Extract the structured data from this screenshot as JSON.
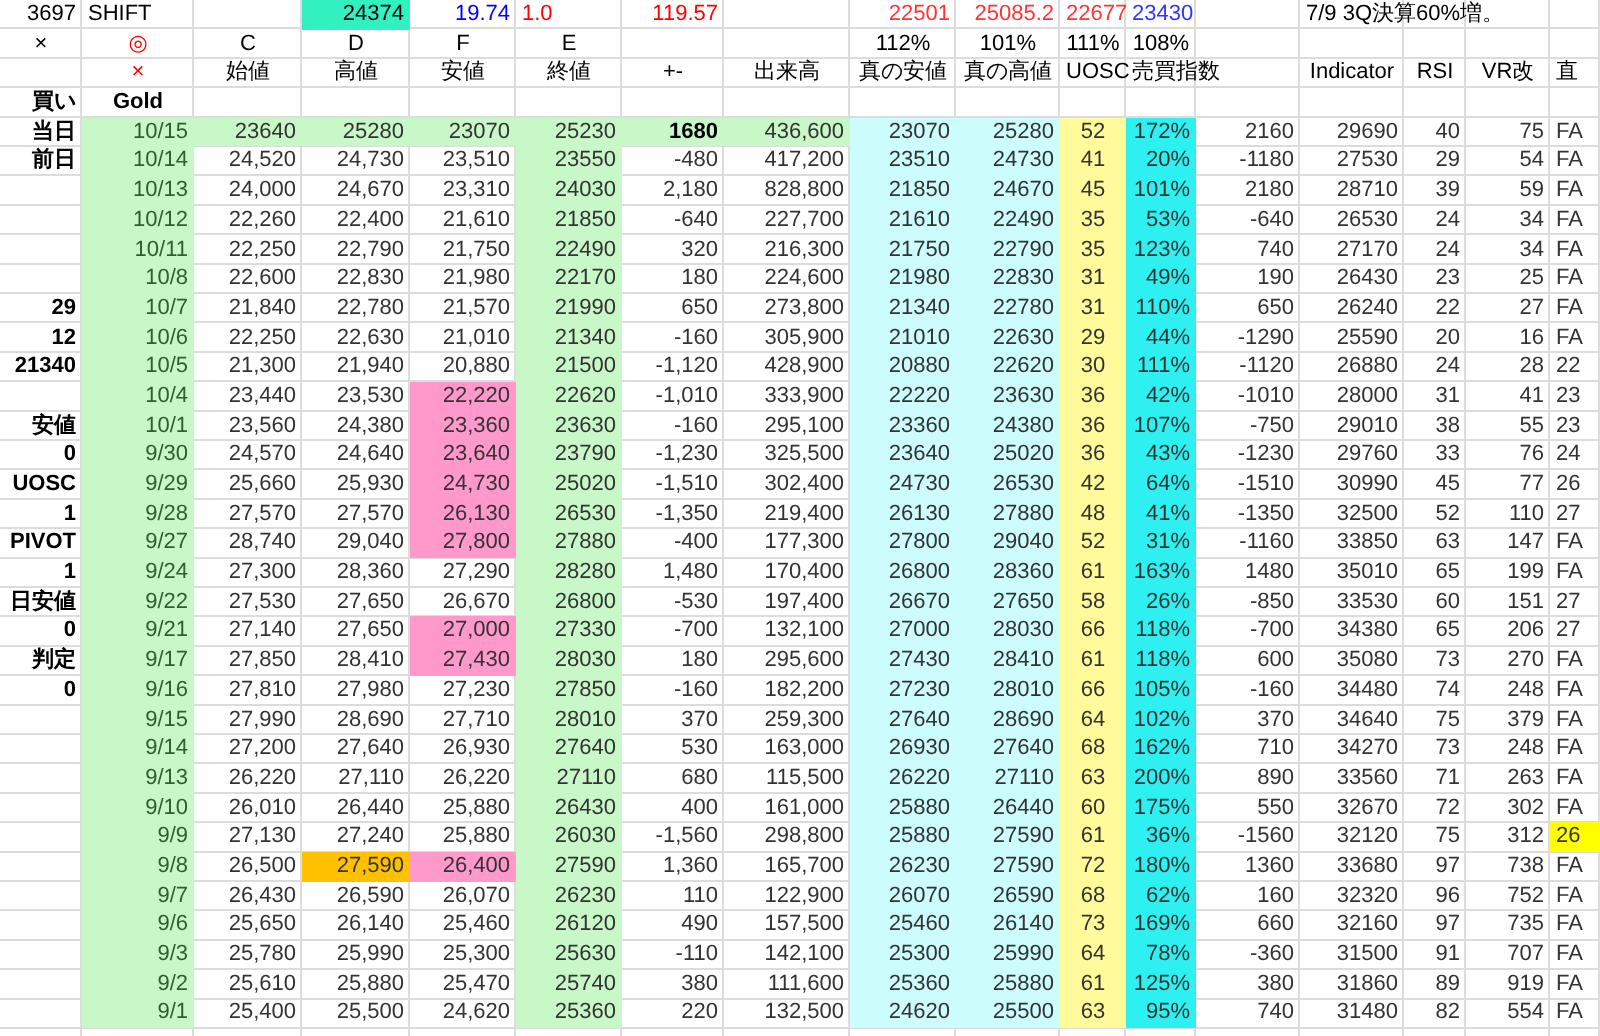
{
  "header_rows": [
    [
      {
        "text": "3697",
        "color": "#000000",
        "highlighted": false
      },
      {
        "text": "SHIFT",
        "color": "#000000",
        "highlighted": false
      },
      null,
      {
        "text": "24374",
        "highlighted": true
      },
      {
        "text": "19.74",
        "color": "#0000ff",
        "highlighted": false
      },
      {
        "text": "1.0",
        "color": "#ff0000",
        "highlighted": false
      },
      {
        "text": "119.57",
        "color": "#ff0000",
        "highlighted": false
      },
      null,
      {
        "text": "22501",
        "color": "#ff3333",
        "highlighted": false
      },
      {
        "text": "25085.2",
        "color": "#ff3333",
        "highlighted": false
      },
      {
        "text": "22677",
        "color": "#ff3333",
        "highlighted": false
      },
      {
        "text": "23430",
        "color": "#3333ff",
        "highlighted": false
      },
      null,
      {
        "text": "7/9 3Q決算60%増。",
        "color": "#000000",
        "highlighted": false
      },
      null,
      null,
      null
    ],
    [
      {
        "text": "×",
        "color": "#000000"
      },
      {
        "text": "◎",
        "color": "#ff0000"
      },
      {
        "text": "C",
        "color": "#000000"
      },
      {
        "text": "D",
        "color": "#000000"
      },
      {
        "text": "F",
        "color": "#000000"
      },
      {
        "text": "E",
        "color": "#000000"
      },
      null,
      null,
      {
        "text": "112%",
        "color": "#000000"
      },
      {
        "text": "101%",
        "color": "#000000"
      },
      {
        "text": "111%",
        "color": "#000000"
      },
      {
        "text": "108%",
        "color": "#000000"
      },
      null,
      null,
      null,
      null,
      null
    ],
    [
      null,
      {
        "text": "×",
        "color": "#ff0000"
      },
      {
        "text": "始値",
        "color": "#000000"
      },
      {
        "text": "高値",
        "color": "#000000"
      },
      {
        "text": "安値",
        "color": "#000000"
      },
      {
        "text": "終値",
        "color": "#000000"
      },
      {
        "text": "+-",
        "color": "#000000"
      },
      {
        "text": "出来高",
        "color": "#000000"
      },
      {
        "text": "真の安値",
        "color": "#000000"
      },
      {
        "text": "真の高値",
        "color": "#000000"
      },
      {
        "text": "UOSC",
        "color": "#000000"
      },
      {
        "text": "売買指数",
        "color": "#000000"
      },
      null,
      {
        "text": "Indicator",
        "color": "#000000"
      },
      {
        "text": "RSI",
        "color": "#000000"
      },
      {
        "text": "VR改",
        "color": "#000000"
      },
      {
        "text": "直",
        "color": "#000000"
      }
    ],
    [
      {
        "text": "買い",
        "color": "#000000"
      },
      {
        "text": "Gold",
        "color": "#000000"
      },
      null,
      null,
      null,
      null,
      null,
      null,
      null,
      null,
      null,
      null,
      null,
      null,
      null,
      null,
      null
    ]
  ],
  "rows": [
    {
      "label": "当日",
      "today": true,
      "low_flag": false,
      "high_flag": false,
      "last_flag": false,
      "cells": [
        "10/15",
        "23640",
        "25280",
        "23070",
        "25230",
        "1680",
        "436,600",
        "23070",
        "25280",
        "52",
        "172%",
        "2160",
        "29690",
        "40",
        "75",
        "FA"
      ]
    },
    {
      "label": "前日",
      "today": false,
      "low_flag": false,
      "high_flag": false,
      "last_flag": false,
      "cells": [
        "10/14",
        "24,520",
        "24,730",
        "23,510",
        "23550",
        "-480",
        "417,200",
        "23510",
        "24730",
        "41",
        "20%",
        "-1180",
        "27530",
        "29",
        "54",
        "FA"
      ]
    },
    {
      "today": false,
      "low_flag": false,
      "high_flag": false,
      "last_flag": false,
      "cells": [
        "10/13",
        "24,000",
        "24,670",
        "23,310",
        "24030",
        "2,180",
        "828,800",
        "21850",
        "24670",
        "45",
        "101%",
        "2180",
        "28710",
        "39",
        "59",
        "FA"
      ]
    },
    {
      "today": false,
      "low_flag": false,
      "high_flag": false,
      "last_flag": false,
      "cells": [
        "10/12",
        "22,260",
        "22,400",
        "21,610",
        "21850",
        "-640",
        "227,700",
        "21610",
        "22490",
        "35",
        "53%",
        "-640",
        "26530",
        "24",
        "34",
        "FA"
      ]
    },
    {
      "today": false,
      "low_flag": false,
      "high_flag": false,
      "last_flag": false,
      "cells": [
        "10/11",
        "22,250",
        "22,790",
        "21,750",
        "22490",
        "320",
        "216,300",
        "21750",
        "22790",
        "35",
        "123%",
        "740",
        "27170",
        "24",
        "34",
        "FA"
      ]
    },
    {
      "today": false,
      "low_flag": false,
      "high_flag": false,
      "last_flag": false,
      "cells": [
        "10/8",
        "22,600",
        "22,830",
        "21,980",
        "22170",
        "180",
        "224,600",
        "21980",
        "22830",
        "31",
        "49%",
        "190",
        "26430",
        "23",
        "25",
        "FA"
      ]
    },
    {
      "label": "29",
      "today": false,
      "low_flag": false,
      "high_flag": false,
      "last_flag": false,
      "cells": [
        "10/7",
        "21,840",
        "22,780",
        "21,570",
        "21990",
        "650",
        "273,800",
        "21340",
        "22780",
        "31",
        "110%",
        "650",
        "26240",
        "22",
        "27",
        "FA"
      ]
    },
    {
      "label": "12",
      "today": false,
      "low_flag": false,
      "high_flag": false,
      "last_flag": false,
      "cells": [
        "10/6",
        "22,250",
        "22,630",
        "21,010",
        "21340",
        "-160",
        "305,900",
        "21010",
        "22630",
        "29",
        "44%",
        "-1290",
        "25590",
        "20",
        "16",
        "FA"
      ]
    },
    {
      "label": "21340",
      "today": false,
      "low_flag": false,
      "high_flag": false,
      "last_flag": false,
      "cells": [
        "10/5",
        "21,300",
        "21,940",
        "20,880",
        "21500",
        "-1,120",
        "428,900",
        "20880",
        "22620",
        "30",
        "111%",
        "-1120",
        "26880",
        "24",
        "28",
        "22"
      ]
    },
    {
      "today": false,
      "low_flag": true,
      "high_flag": false,
      "last_flag": false,
      "cells": [
        "10/4",
        "23,440",
        "23,530",
        "22,220",
        "22620",
        "-1,010",
        "333,900",
        "22220",
        "23630",
        "36",
        "42%",
        "-1010",
        "28000",
        "31",
        "41",
        "23"
      ]
    },
    {
      "label": "安値",
      "today": false,
      "low_flag": true,
      "high_flag": false,
      "last_flag": false,
      "cells": [
        "10/1",
        "23,560",
        "24,380",
        "23,360",
        "23630",
        "-160",
        "295,100",
        "23360",
        "24380",
        "36",
        "107%",
        "-750",
        "29010",
        "38",
        "55",
        "23"
      ]
    },
    {
      "label": "0",
      "today": false,
      "low_flag": true,
      "high_flag": false,
      "last_flag": false,
      "cells": [
        "9/30",
        "24,570",
        "24,640",
        "23,640",
        "23790",
        "-1,230",
        "325,500",
        "23640",
        "25020",
        "36",
        "43%",
        "-1230",
        "29760",
        "33",
        "76",
        "24"
      ]
    },
    {
      "label": "UOSC",
      "today": false,
      "low_flag": true,
      "high_flag": false,
      "last_flag": false,
      "cells": [
        "9/29",
        "25,660",
        "25,930",
        "24,730",
        "25020",
        "-1,510",
        "302,400",
        "24730",
        "26530",
        "42",
        "64%",
        "-1510",
        "30990",
        "45",
        "77",
        "26"
      ]
    },
    {
      "label": "1",
      "today": false,
      "low_flag": true,
      "high_flag": false,
      "last_flag": false,
      "cells": [
        "9/28",
        "27,570",
        "27,570",
        "26,130",
        "26530",
        "-1,350",
        "219,400",
        "26130",
        "27880",
        "48",
        "41%",
        "-1350",
        "32500",
        "52",
        "110",
        "27"
      ]
    },
    {
      "label": "PIVOT",
      "today": false,
      "low_flag": true,
      "high_flag": false,
      "last_flag": false,
      "cells": [
        "9/27",
        "28,740",
        "29,040",
        "27,800",
        "27880",
        "-400",
        "177,300",
        "27800",
        "29040",
        "52",
        "31%",
        "-1160",
        "33850",
        "63",
        "147",
        "FA"
      ]
    },
    {
      "label": "1",
      "today": false,
      "low_flag": false,
      "high_flag": false,
      "last_flag": false,
      "cells": [
        "9/24",
        "27,300",
        "28,360",
        "27,290",
        "28280",
        "1,480",
        "170,400",
        "26800",
        "28360",
        "61",
        "163%",
        "1480",
        "35010",
        "65",
        "199",
        "FA"
      ]
    },
    {
      "label": "日安値",
      "today": false,
      "low_flag": false,
      "high_flag": false,
      "last_flag": false,
      "cells": [
        "9/22",
        "27,530",
        "27,650",
        "26,670",
        "26800",
        "-530",
        "197,400",
        "26670",
        "27650",
        "58",
        "26%",
        "-850",
        "33530",
        "60",
        "151",
        "27"
      ]
    },
    {
      "label": "0",
      "today": false,
      "low_flag": true,
      "high_flag": false,
      "last_flag": false,
      "cells": [
        "9/21",
        "27,140",
        "27,650",
        "27,000",
        "27330",
        "-700",
        "132,100",
        "27000",
        "28030",
        "66",
        "118%",
        "-700",
        "34380",
        "65",
        "206",
        "27"
      ]
    },
    {
      "label": "判定",
      "today": false,
      "low_flag": true,
      "high_flag": false,
      "last_flag": false,
      "cells": [
        "9/17",
        "27,850",
        "28,410",
        "27,430",
        "28030",
        "180",
        "295,600",
        "27430",
        "28410",
        "61",
        "118%",
        "600",
        "35080",
        "73",
        "270",
        "FA"
      ]
    },
    {
      "label": "0",
      "today": false,
      "low_flag": false,
      "high_flag": false,
      "last_flag": false,
      "cells": [
        "9/16",
        "27,810",
        "27,980",
        "27,230",
        "27850",
        "-160",
        "182,200",
        "27230",
        "28010",
        "66",
        "105%",
        "-160",
        "34480",
        "74",
        "248",
        "FA"
      ]
    },
    {
      "today": false,
      "low_flag": false,
      "high_flag": false,
      "last_flag": false,
      "cells": [
        "9/15",
        "27,990",
        "28,690",
        "27,710",
        "28010",
        "370",
        "259,300",
        "27640",
        "28690",
        "64",
        "102%",
        "370",
        "34640",
        "75",
        "379",
        "FA"
      ]
    },
    {
      "today": false,
      "low_flag": false,
      "high_flag": false,
      "last_flag": false,
      "cells": [
        "9/14",
        "27,200",
        "27,640",
        "26,930",
        "27640",
        "530",
        "163,000",
        "26930",
        "27640",
        "68",
        "162%",
        "710",
        "34270",
        "73",
        "248",
        "FA"
      ]
    },
    {
      "today": false,
      "low_flag": false,
      "high_flag": false,
      "last_flag": false,
      "cells": [
        "9/13",
        "26,220",
        "27,110",
        "26,220",
        "27110",
        "680",
        "115,500",
        "26220",
        "27110",
        "63",
        "200%",
        "890",
        "33560",
        "71",
        "263",
        "FA"
      ]
    },
    {
      "today": false,
      "low_flag": false,
      "high_flag": false,
      "last_flag": false,
      "cells": [
        "9/10",
        "26,010",
        "26,440",
        "25,880",
        "26430",
        "400",
        "161,000",
        "25880",
        "26440",
        "60",
        "175%",
        "550",
        "32670",
        "72",
        "302",
        "FA"
      ]
    },
    {
      "today": false,
      "low_flag": false,
      "high_flag": false,
      "last_flag": true,
      "cells": [
        "9/9",
        "27,130",
        "27,240",
        "25,880",
        "26030",
        "-1,560",
        "298,800",
        "25880",
        "27590",
        "61",
        "36%",
        "-1560",
        "32120",
        "75",
        "312",
        "26"
      ]
    },
    {
      "today": false,
      "low_flag": true,
      "high_flag": true,
      "last_flag": false,
      "cells": [
        "9/8",
        "26,500",
        "27,590",
        "26,400",
        "27590",
        "1,360",
        "165,700",
        "26230",
        "27590",
        "72",
        "180%",
        "1360",
        "33680",
        "97",
        "738",
        "FA"
      ]
    },
    {
      "today": false,
      "low_flag": false,
      "high_flag": false,
      "last_flag": false,
      "cells": [
        "9/7",
        "26,430",
        "26,590",
        "26,070",
        "26230",
        "110",
        "122,900",
        "26070",
        "26590",
        "68",
        "62%",
        "160",
        "32320",
        "96",
        "752",
        "FA"
      ]
    },
    {
      "today": false,
      "low_flag": false,
      "high_flag": false,
      "last_flag": false,
      "cells": [
        "9/6",
        "25,650",
        "26,140",
        "25,460",
        "26120",
        "490",
        "157,500",
        "25460",
        "26140",
        "73",
        "169%",
        "660",
        "32160",
        "97",
        "735",
        "FA"
      ]
    },
    {
      "today": false,
      "low_flag": false,
      "high_flag": false,
      "last_flag": false,
      "cells": [
        "9/3",
        "25,780",
        "25,990",
        "25,300",
        "25630",
        "-110",
        "142,100",
        "25300",
        "25990",
        "64",
        "78%",
        "-360",
        "31500",
        "91",
        "707",
        "FA"
      ]
    },
    {
      "today": false,
      "low_flag": false,
      "high_flag": false,
      "last_flag": false,
      "cells": [
        "9/2",
        "25,610",
        "25,880",
        "25,470",
        "25740",
        "380",
        "111,600",
        "25360",
        "25880",
        "61",
        "125%",
        "380",
        "31860",
        "89",
        "919",
        "FA"
      ]
    },
    {
      "today": false,
      "low_flag": false,
      "high_flag": false,
      "last_flag": false,
      "cells": [
        "9/1",
        "25,400",
        "25,500",
        "24,620",
        "25360",
        "220",
        "132,500",
        "24620",
        "25500",
        "63",
        "95%",
        "740",
        "31480",
        "82",
        "554",
        "FA"
      ]
    }
  ]
}
